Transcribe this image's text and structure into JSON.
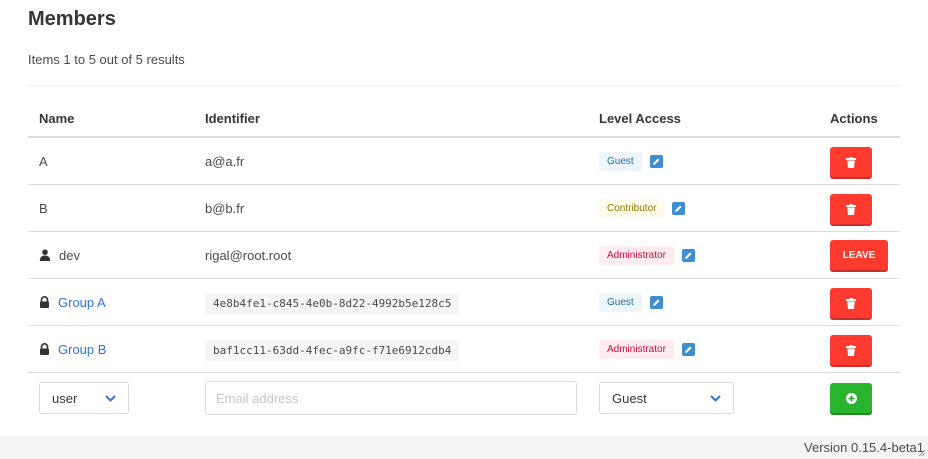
{
  "page": {
    "title": "Members",
    "summary": "Items 1 to 5 out of 5 results"
  },
  "table": {
    "headers": {
      "name": "Name",
      "identifier": "Identifier",
      "level": "Level Access",
      "actions": "Actions"
    },
    "rows": [
      {
        "name": "A",
        "identifier": "a@a.fr",
        "level": "Guest",
        "action": "delete"
      },
      {
        "name": "B",
        "identifier": "b@b.fr",
        "level": "Contributor",
        "action": "delete"
      },
      {
        "name": "dev",
        "identifier": "rigal@root.root",
        "level": "Administrator",
        "action": "leave"
      },
      {
        "name": "Group A",
        "identifier": "4e8b4fe1-c845-4e0b-8d22-4992b5e128c5",
        "level": "Guest",
        "action": "delete"
      },
      {
        "name": "Group B",
        "identifier": "baf1cc11-63dd-4fec-a9fc-f71e6912cdb4",
        "level": "Administrator",
        "action": "delete"
      }
    ],
    "leave_label": "LEAVE"
  },
  "form": {
    "type_value": "user",
    "email_placeholder": "Email address",
    "level_value": "Guest"
  },
  "footer": {
    "version": "Version 0.15.4-beta1"
  },
  "colors": {
    "danger": "#ff3b30",
    "success": "#28b42c",
    "link": "#3273dc",
    "edit": "#3e8ed0"
  }
}
